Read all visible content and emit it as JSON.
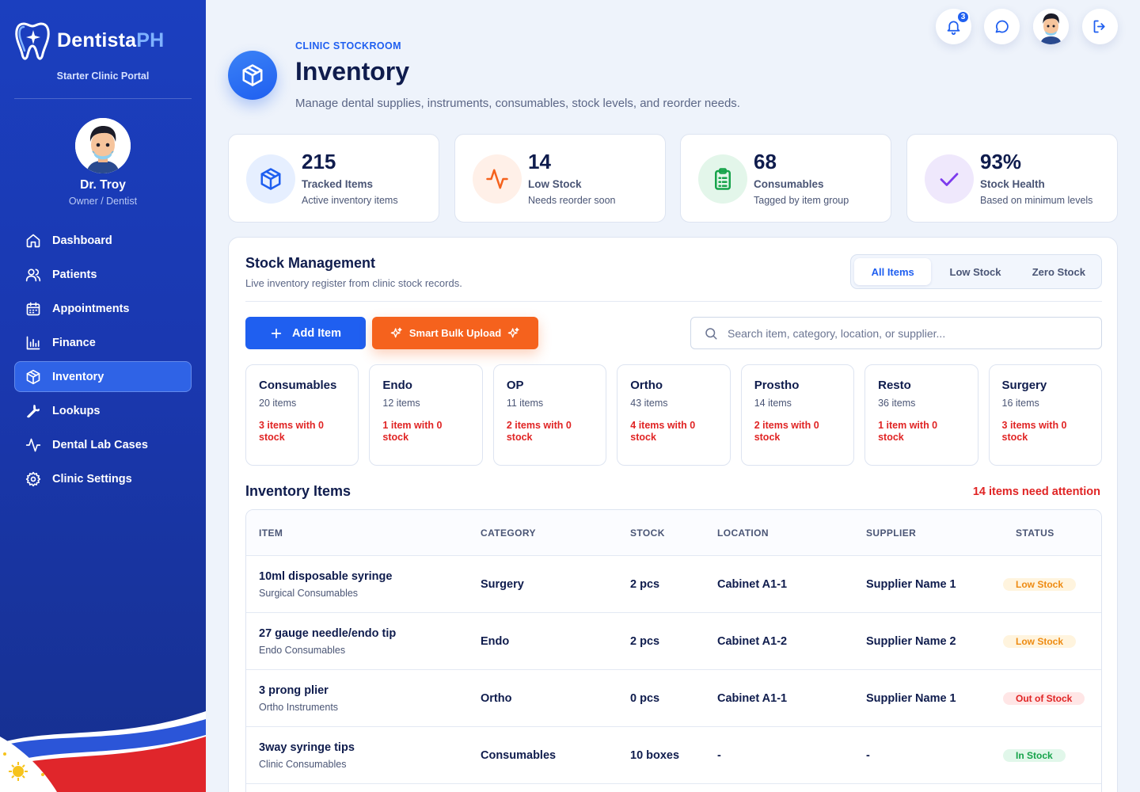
{
  "brand": {
    "name_main": "Dentista",
    "name_accent": "PH",
    "portal_label": "Starter Clinic Portal"
  },
  "user": {
    "name": "Dr. Troy",
    "role": "Owner / Dentist"
  },
  "nav": [
    {
      "label": "Dashboard",
      "icon": "home-icon"
    },
    {
      "label": "Patients",
      "icon": "users-icon"
    },
    {
      "label": "Appointments",
      "icon": "calendar-icon"
    },
    {
      "label": "Finance",
      "icon": "bar-chart-icon"
    },
    {
      "label": "Inventory",
      "icon": "box-icon",
      "active": true
    },
    {
      "label": "Lookups",
      "icon": "wrench-icon"
    },
    {
      "label": "Dental Lab Cases",
      "icon": "activity-icon"
    },
    {
      "label": "Clinic Settings",
      "icon": "gear-icon"
    }
  ],
  "topbar": {
    "notification_count": "3"
  },
  "header": {
    "eyebrow": "CLINIC STOCKROOM",
    "title": "Inventory",
    "subtitle": "Manage dental supplies, instruments, consumables, stock levels, and reorder needs."
  },
  "stats": [
    {
      "value": "215",
      "label": "Tracked Items",
      "desc": "Active inventory items",
      "icon": "box-icon",
      "color": "#1f5ff0"
    },
    {
      "value": "14",
      "label": "Low Stock",
      "desc": "Needs reorder soon",
      "icon": "activity-icon",
      "color": "#f5621d"
    },
    {
      "value": "68",
      "label": "Consumables",
      "desc": "Tagged by item group",
      "icon": "clipboard-icon",
      "color": "#16a34a"
    },
    {
      "value": "93%",
      "label": "Stock Health",
      "desc": "Based on minimum levels",
      "icon": "check-icon",
      "color": "#7c3aed"
    }
  ],
  "panel": {
    "title": "Stock Management",
    "subtitle": "Live inventory register from clinic stock records.",
    "tabs": [
      {
        "label": "All Items",
        "active": true
      },
      {
        "label": "Low Stock"
      },
      {
        "label": "Zero Stock"
      }
    ],
    "add_label": "Add Item",
    "bulk_label": "Smart Bulk Upload",
    "search_placeholder": "Search item, category, location, or supplier..."
  },
  "categories": [
    {
      "name": "Consumables",
      "count": "20 items",
      "zero": "3 items with 0 stock"
    },
    {
      "name": "Endo",
      "count": "12 items",
      "zero": "1 item with 0 stock"
    },
    {
      "name": "OP",
      "count": "11 items",
      "zero": "2 items with 0 stock"
    },
    {
      "name": "Ortho",
      "count": "43 items",
      "zero": "4 items with 0 stock"
    },
    {
      "name": "Prostho",
      "count": "14 items",
      "zero": "2 items with 0 stock"
    },
    {
      "name": "Resto",
      "count": "36 items",
      "zero": "1 item with 0 stock"
    },
    {
      "name": "Surgery",
      "count": "16 items",
      "zero": "3 items with 0 stock"
    }
  ],
  "items": {
    "title": "Inventory Items",
    "attention": "14 items need attention",
    "columns": [
      "ITEM",
      "CATEGORY",
      "STOCK",
      "LOCATION",
      "SUPPLIER",
      "STATUS"
    ],
    "rows": [
      {
        "name": "10ml disposable syringe",
        "group": "Surgical Consumables",
        "category": "Surgery",
        "stock": "2 pcs",
        "location": "Cabinet A1-1",
        "supplier": "Supplier Name 1",
        "status": "Low Stock",
        "status_type": "low"
      },
      {
        "name": "27 gauge needle/endo tip",
        "group": "Endo Consumables",
        "category": "Endo",
        "stock": "2 pcs",
        "location": "Cabinet A1-2",
        "supplier": "Supplier Name 2",
        "status": "Low Stock",
        "status_type": "low"
      },
      {
        "name": "3 prong plier",
        "group": "Ortho Instruments",
        "category": "Ortho",
        "stock": "0 pcs",
        "location": "Cabinet A1-1",
        "supplier": "Supplier Name 1",
        "status": "Out of Stock",
        "status_type": "out"
      },
      {
        "name": "3way syringe tips",
        "group": "Clinic Consumables",
        "category": "Consumables",
        "stock": "10 boxes",
        "location": "-",
        "supplier": "-",
        "status": "In Stock",
        "status_type": "in"
      }
    ]
  }
}
